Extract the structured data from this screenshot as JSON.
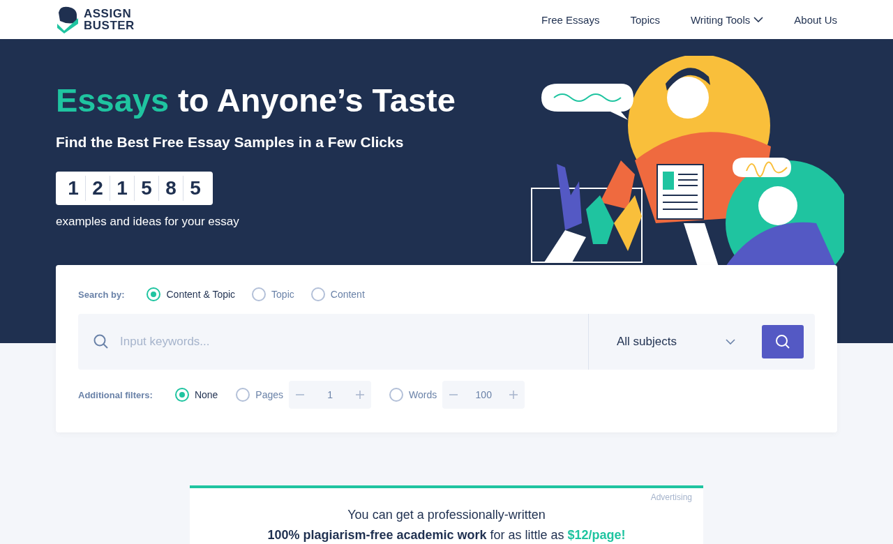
{
  "header": {
    "logo": {
      "line_1": "ASSIGN",
      "line_2": "BUSTER"
    },
    "nav": [
      {
        "label": "Free Essays",
        "has_dropdown": false
      },
      {
        "label": "Topics",
        "has_dropdown": false
      },
      {
        "label": "Writing Tools",
        "has_dropdown": true
      },
      {
        "label": "About Us",
        "has_dropdown": false
      }
    ]
  },
  "hero": {
    "headline_accent": "Essays",
    "headline_rest": "to Anyone’s Taste",
    "subtitle": "Find the Best Free Essay Samples in a Few Clicks",
    "counter_digits": [
      "1",
      "2",
      "1",
      "5",
      "8",
      "5"
    ],
    "counter_caption": "examples and ideas for your essay"
  },
  "search": {
    "search_by_label": "Search by:",
    "search_by_options": [
      {
        "label": "Content & Topic",
        "selected": true
      },
      {
        "label": "Topic",
        "selected": false
      },
      {
        "label": "Content",
        "selected": false
      }
    ],
    "keyword_field": {
      "placeholder": "Input keywords..."
    },
    "subject_select": {
      "value": "All subjects"
    },
    "filters_label": "Additional filters:",
    "filters": [
      {
        "kind": "radio",
        "label": "None",
        "selected": true
      },
      {
        "kind": "stepper",
        "label": "Pages",
        "selected": false,
        "value": "1"
      },
      {
        "kind": "stepper",
        "label": "Words",
        "selected": false,
        "value": "100"
      }
    ]
  },
  "ad": {
    "tag": "Advertising",
    "line_1": "You can get a professionally-written",
    "line_2": "**100% plagiarism-free academic work** for as little as **$12/page!**"
  }
}
